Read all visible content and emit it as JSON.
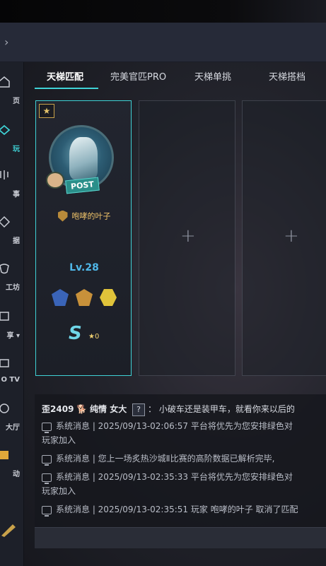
{
  "sidebar": {
    "items": [
      {
        "label": "页",
        "icon": "home-icon"
      },
      {
        "label": "玩",
        "icon": "play-icon",
        "active": true
      },
      {
        "label": "事",
        "icon": "event-icon"
      },
      {
        "label": "据",
        "icon": "data-icon"
      },
      {
        "label": "工坊",
        "icon": "workshop-icon"
      },
      {
        "label": "享 ▾",
        "icon": "share-icon"
      },
      {
        "label": "O TV",
        "icon": "tv-icon"
      },
      {
        "label": "大厅",
        "icon": "lobby-icon"
      },
      {
        "label": "动",
        "icon": "activity-icon"
      }
    ]
  },
  "tabs": [
    {
      "label": "天梯匹配",
      "active": true
    },
    {
      "label": "完美官匹PRO"
    },
    {
      "label": "天梯单挑"
    },
    {
      "label": "天梯搭档"
    }
  ],
  "player_card": {
    "post_tag": "POST",
    "name": "咆哮的叶子",
    "level": "Lv.28",
    "rank_letter": "S",
    "rank_stars": "★0"
  },
  "chat": {
    "first_line": {
      "prefix": "歪",
      "score": "2409",
      "emoji": "🐕",
      "name": "纯情 女大",
      "q": "?",
      "sep": "：",
      "msg": "小破车还是装甲车，就看你来以后的"
    },
    "messages": [
      {
        "text": "系统消息 | 2025/09/13-02:06:57 平台将优先为您安排绿色对",
        "cont": "玩家加入"
      },
      {
        "text": "系统消息 | 您上一场炙热沙城Ⅱ比赛的高阶数据已解析完毕,",
        "cont": ""
      },
      {
        "text": "系统消息 | 2025/09/13-02:35:33 平台将优先为您安排绿色对",
        "cont": "玩家加入"
      },
      {
        "text": "系统消息 | 2025/09/13-02:35:51 玩家 咆哮的叶子 取消了匹配",
        "cont": ""
      }
    ]
  },
  "colors": {
    "accent": "#3fd2d6",
    "gold": "#f0c36a",
    "level": "#4fb7e8"
  }
}
